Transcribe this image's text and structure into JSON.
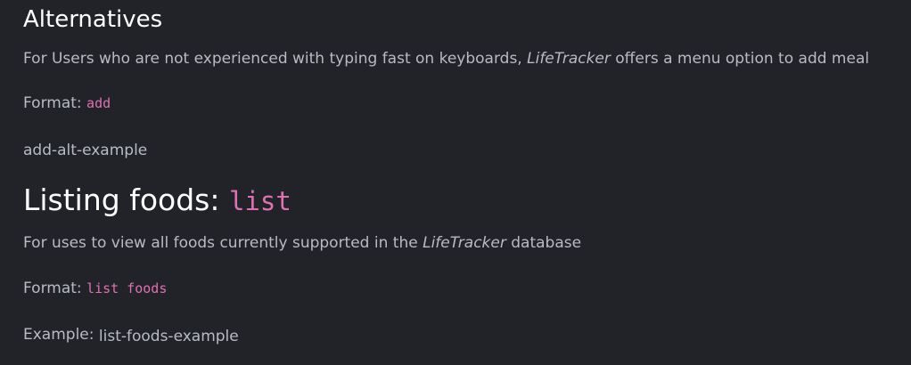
{
  "alternatives": {
    "heading": "Alternatives",
    "description_prefix": "For Users who are not experienced with typing fast on keyboards, ",
    "app_name": "LifeTracker",
    "description_suffix": " offers a menu option to add meal",
    "format_label": "Format: ",
    "format_command": "add",
    "example_image_alt": "add-alt-example"
  },
  "listing": {
    "heading_text": "Listing foods: ",
    "heading_command": "list",
    "description_prefix": "For uses to view all foods currently supported in the ",
    "app_name": "LifeTracker",
    "description_suffix": " database",
    "format_label": "Format: ",
    "format_command": "list foods",
    "example_label": "Example: ",
    "example_image_alt": "list-foods-example"
  },
  "colors": {
    "background": "#212329",
    "body_text": "#b8bcc2",
    "heading_text": "#ffffff",
    "code_text": "#e070b4"
  }
}
